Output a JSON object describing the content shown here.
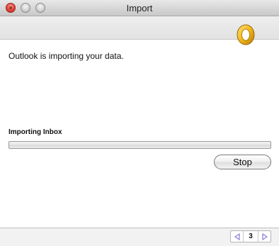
{
  "window": {
    "title": "Import"
  },
  "main": {
    "message": "Outlook is importing your data.",
    "progress_label": "Importing Inbox",
    "progress_fraction": 0.0,
    "stop_label": "Stop"
  },
  "footer": {
    "page_number": "3",
    "prev_icon": "triangle-left-icon",
    "next_icon": "triangle-right-icon"
  },
  "colors": {
    "logo_gold": "#f2b61a",
    "progress_blue": "#5a97dc",
    "pager_arrow": "#8a7bd8"
  },
  "icons": {
    "logo": "outlook-logo-icon"
  }
}
